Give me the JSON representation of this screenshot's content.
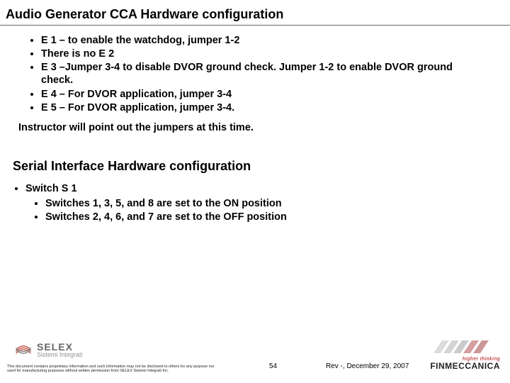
{
  "title": "Audio Generator CCA Hardware configuration",
  "bullets": [
    "E 1 – to enable the watchdog, jumper 1-2",
    "There is no E 2",
    "E 3 –Jumper 3-4 to disable DVOR ground check.  Jumper 1-2 to enable DVOR ground check.",
    "E 4 – For DVOR application, jumper 3-4",
    "E 5 – For DVOR application, jumper 3-4."
  ],
  "instructor_note": "Instructor will point out the jumpers at this time.",
  "section2_title": "Serial Interface Hardware configuration",
  "switch_label": "Switch S 1",
  "switch_items": [
    "Switches 1, 3, 5, and 8 are set to the ON position",
    "Switches 2, 4, 6, and 7 are set to the OFF position"
  ],
  "footer": {
    "selex_line1": "SELEX",
    "selex_line2": "Sistemi Integrati",
    "fin_tag": "higher thinking",
    "fin_name": "FINMECCANICA",
    "disclaimer": "This document contains proprietary information and such information may not be disclosed to others for any purpose nor used for manufacturing purposes without written permission from SELEX Sistemi Integrati Inc.",
    "page": "54",
    "rev": "Rev -, December 29, 2007"
  }
}
